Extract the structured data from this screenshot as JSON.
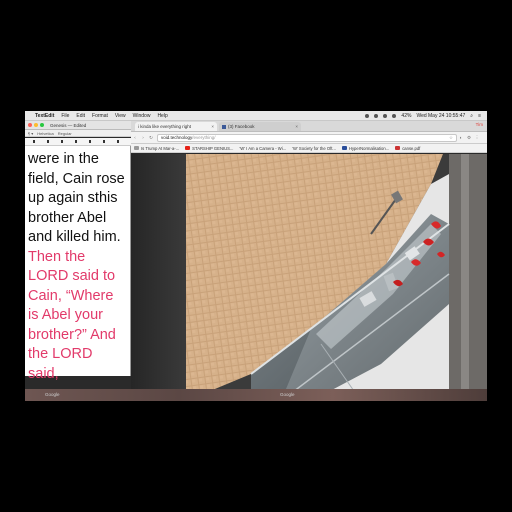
{
  "menubar": {
    "app_name": "TextEdit",
    "items": [
      "File",
      "Edit",
      "Format",
      "View",
      "Window",
      "Help"
    ],
    "datetime": "Wed May 24  10:55:47",
    "battery": "42%"
  },
  "textedit": {
    "title": "Genesis — Edited",
    "font_family": "Helvetica",
    "font_style": "Regular",
    "text_black": "were in the field, Cain rose up again sthis brother Abel and killed him.",
    "text_red": "Then the LORD said to Cain, “Where is Abel your brother?” And the LORD said,",
    "accent_red": "#e23a6a"
  },
  "browser": {
    "tabs": [
      {
        "label": "i kinda like everything right",
        "active": true
      },
      {
        "label": "(3) Facebook",
        "active": false
      }
    ],
    "user": "Tim",
    "url_host": "void.technology",
    "url_path": "/everything/",
    "bookmarks": [
      {
        "label": "Is Trump At Mar-a-...",
        "icon": "doc-icon",
        "color": "#999999"
      },
      {
        "label": "STARSHIP GENIUS...",
        "icon": "youtube-icon",
        "color": "#e62117"
      },
      {
        "label": "'W' I Am a Camera - Wi...",
        "icon": "wiki-icon",
        "color": "#777777"
      },
      {
        "label": "'W' Society for the Oft...",
        "icon": "wiki-icon",
        "color": "#777777"
      },
      {
        "label": "HyperNormalisation...",
        "icon": "hn-icon",
        "color": "#2a4d9a"
      },
      {
        "label": "canse.pdf",
        "icon": "pdf-icon",
        "color": "#cc3333"
      }
    ]
  },
  "bottom": {
    "left_label": "Google",
    "right_label": "Google"
  }
}
